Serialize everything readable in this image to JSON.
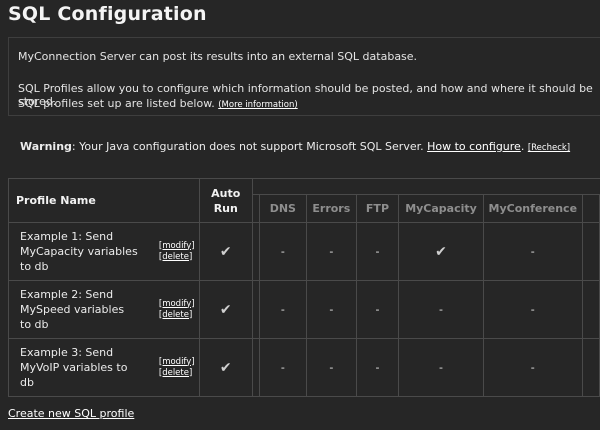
{
  "title": "SQL Configuration",
  "info": {
    "line1": "MyConnection Server can post its results into an external SQL database.",
    "line2": "SQL Profiles allow you to configure which information should be posted, and how and where it should be stored.",
    "line3": "SQL profiles set up are listed below.",
    "more_link": "(More information)"
  },
  "warning": {
    "label": "Warning",
    "text": ": Your Java configuration does not support Microsoft SQL Server. ",
    "how_link": "How to configure",
    "period": ".",
    "recheck": "[Recheck]"
  },
  "table": {
    "headers": {
      "profile_name": "Profile Name",
      "auto_run_1": "Auto",
      "auto_run_2": "Run",
      "columns": [
        "DNS",
        "Errors",
        "FTP",
        "MyCapacity",
        "MyConference"
      ]
    },
    "rows": [
      {
        "name": "Example 1: Send MyCapacity variables to db",
        "modify": "[modify]",
        "delete": "[delete]",
        "auto_run": "✔",
        "cells": [
          "-",
          "-",
          "-",
          "✔",
          "-"
        ]
      },
      {
        "name": "Example 2: Send MySpeed variables to db",
        "modify": "[modify]",
        "delete": "[delete]",
        "auto_run": "✔",
        "cells": [
          "-",
          "-",
          "-",
          "-",
          "-"
        ]
      },
      {
        "name": "Example 3: Send MyVoIP variables to db",
        "modify": "[modify]",
        "delete": "[delete]",
        "auto_run": "✔",
        "cells": [
          "-",
          "-",
          "-",
          "-",
          "-"
        ]
      }
    ]
  },
  "create_link": "Create new SQL profile"
}
